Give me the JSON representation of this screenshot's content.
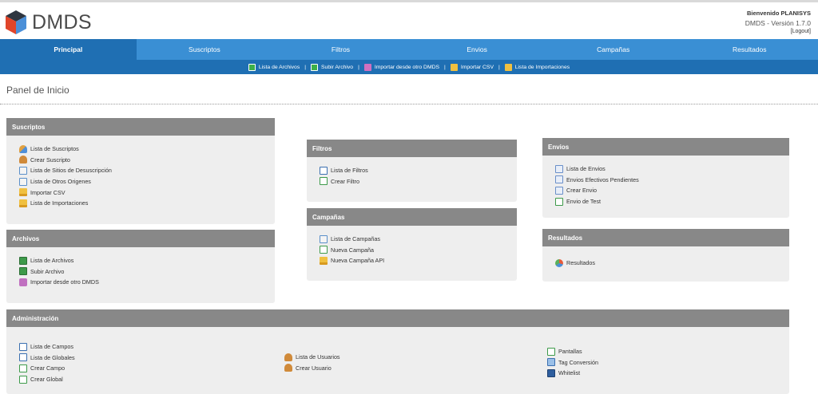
{
  "header": {
    "logo_text": "DMDS",
    "welcome": "Bienvenido PLANISYS",
    "version": "DMDS - Versión 1.7.0",
    "logout": "[Logout]"
  },
  "main_nav": [
    "Principal",
    "Suscriptos",
    "Filtros",
    "Envios",
    "Campañas",
    "Resultados"
  ],
  "sub_nav": [
    "Lista de Archivos",
    "Subir Archivo",
    "Importar desde otro DMDS",
    "Importar CSV",
    "Lista de Importaciones"
  ],
  "page_title": "Panel de Inicio",
  "panels": {
    "suscriptos": {
      "title": "Suscriptos",
      "items": [
        "Lista de Suscriptos",
        "Crear Suscripto",
        "Lista de Sitios de Desuscripción",
        "Lista de Otros Origenes",
        "Importar CSV",
        "Lista de Importaciones"
      ]
    },
    "archivos": {
      "title": "Archivos",
      "items": [
        "Lista de Archivos",
        "Subir Archivo",
        "Importar desde otro DMDS"
      ]
    },
    "filtros": {
      "title": "Filtros",
      "items": [
        "Lista de Filtros",
        "Crear Filtro"
      ]
    },
    "campanas": {
      "title": "Campañas",
      "items": [
        "Lista de Campañas",
        "Nueva Campaña",
        "Nueva Campaña API"
      ]
    },
    "envios": {
      "title": "Envios",
      "items": [
        "Lista de Envios",
        "Envios Efectivos Pendientes",
        "Crear Envio",
        "Envio de Test"
      ]
    },
    "resultados": {
      "title": "Resultados",
      "items": [
        "Resultados"
      ]
    },
    "administracion": {
      "title": "Administración",
      "col1": [
        "Lista de Campos",
        "Lista de Globales",
        "Crear Campo",
        "Crear Global"
      ],
      "col2": [
        "Lista de Usuarios",
        "Crear Usuario"
      ],
      "col3": [
        "Pantallas",
        "Tag Conversión",
        "Whitelist"
      ]
    }
  },
  "colors": {
    "nav_blue": "#3a8fd4",
    "nav_dark_blue": "#1f6fb3",
    "panel_header": "#888888",
    "panel_body": "#eeeeee"
  }
}
